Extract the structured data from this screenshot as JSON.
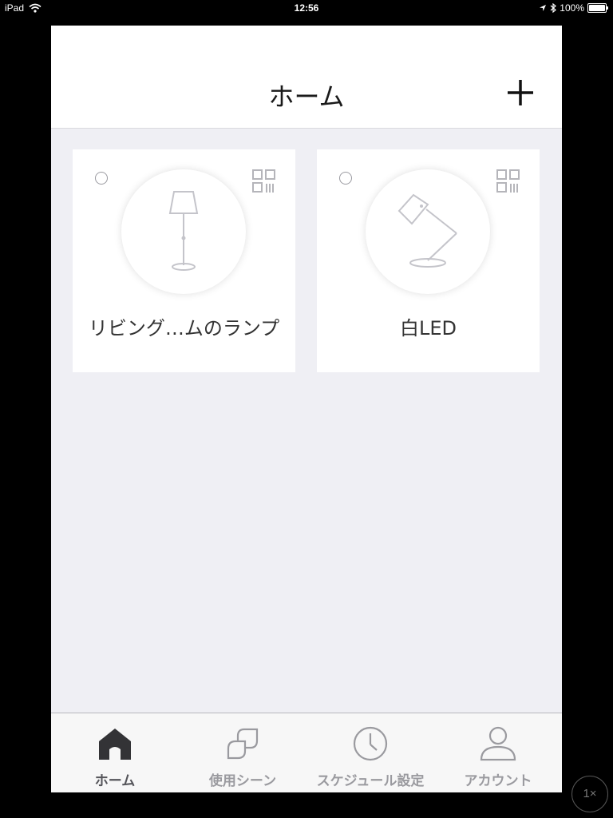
{
  "status_bar": {
    "device": "iPad",
    "time": "12:56",
    "battery": "100%"
  },
  "header": {
    "title": "ホーム",
    "add_icon": "plus-icon"
  },
  "devices": [
    {
      "name": "リビング…ムのランプ",
      "icon": "floor-lamp-icon"
    },
    {
      "name": "白LED",
      "icon": "desk-lamp-icon"
    }
  ],
  "tabs": [
    {
      "label": "ホーム",
      "icon": "home-icon",
      "active": true
    },
    {
      "label": "使用シーン",
      "icon": "scenes-icon",
      "active": false
    },
    {
      "label": "スケジュール設定",
      "icon": "clock-icon",
      "active": false
    },
    {
      "label": "アカウント",
      "icon": "person-icon",
      "active": false
    }
  ],
  "zoom_label": "1×",
  "colors": {
    "background": "#efeff4",
    "tab_active": "#55555a",
    "tab_inactive": "#9a9a9f"
  }
}
